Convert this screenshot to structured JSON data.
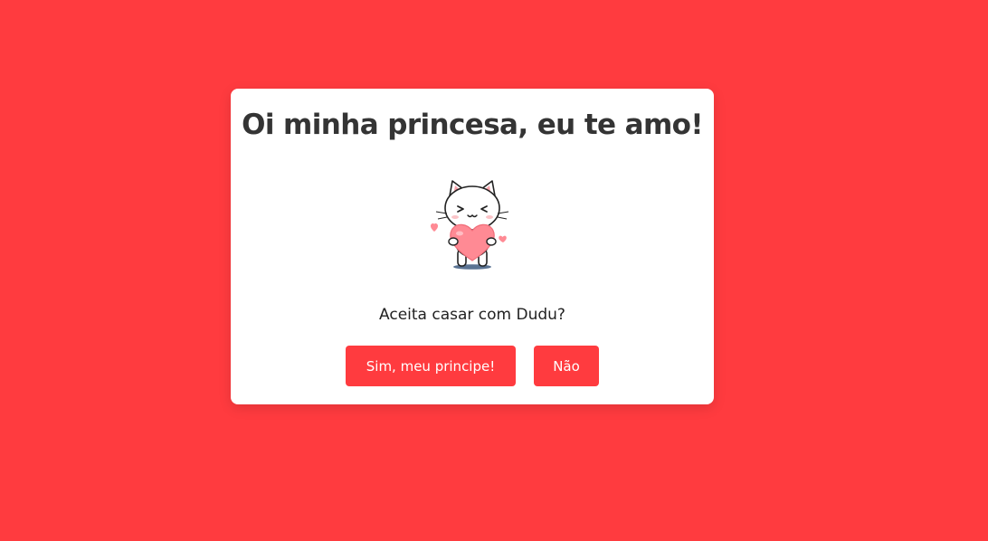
{
  "page": {
    "background_color": "#ff3b3f"
  },
  "card": {
    "title": "Oi minha princesa, eu te amo!",
    "illustration": "cat-holding-heart-icon",
    "question": "Aceita casar com Dudu?",
    "buttons": {
      "yes_label": "Sim, meu principe!",
      "no_label": "Não",
      "color": "#ff3b3f"
    }
  }
}
